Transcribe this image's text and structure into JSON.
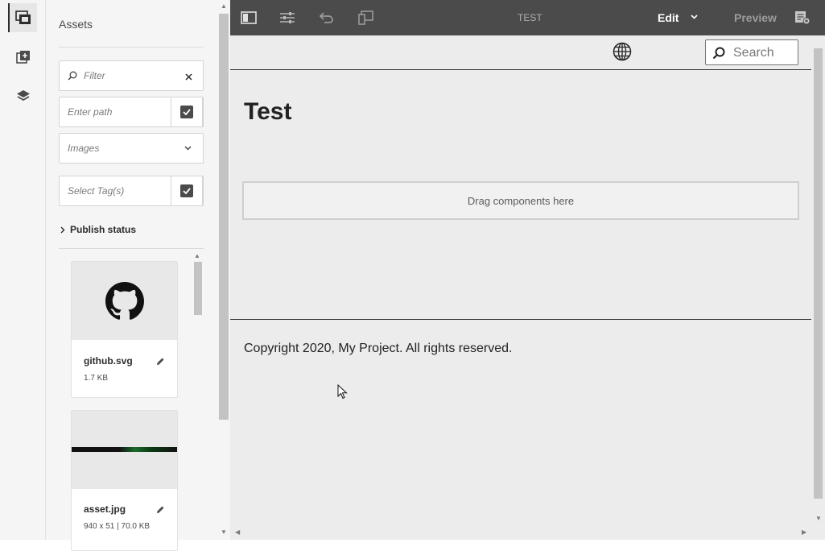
{
  "rail": {
    "items": [
      {
        "name": "assets-finder",
        "active": true
      },
      {
        "name": "components",
        "active": false
      },
      {
        "name": "content-tree",
        "active": false
      }
    ]
  },
  "assets_panel": {
    "title": "Assets",
    "filter": {
      "placeholder": "Filter"
    },
    "path": {
      "placeholder": "Enter path"
    },
    "type_select": {
      "value": "Images"
    },
    "tags": {
      "placeholder": "Select Tag(s)"
    },
    "publish_status": "Publish status",
    "assets": [
      {
        "name": "github.svg",
        "meta": "1.7 KB"
      },
      {
        "name": "asset.jpg",
        "meta": "940 x 51 | 70.0 KB"
      }
    ]
  },
  "toolbar": {
    "page_title": "TEST",
    "mode": "Edit",
    "preview": "Preview"
  },
  "page": {
    "search_placeholder": "Search",
    "heading": "Test",
    "dropzone": "Drag components here",
    "footer": "Copyright 2020, My Project. All rights reserved."
  },
  "colors": {
    "toolbar_bg": "#4b4b4b",
    "panel_bg": "#f5f5f5",
    "canvas_bg": "#ececec"
  }
}
